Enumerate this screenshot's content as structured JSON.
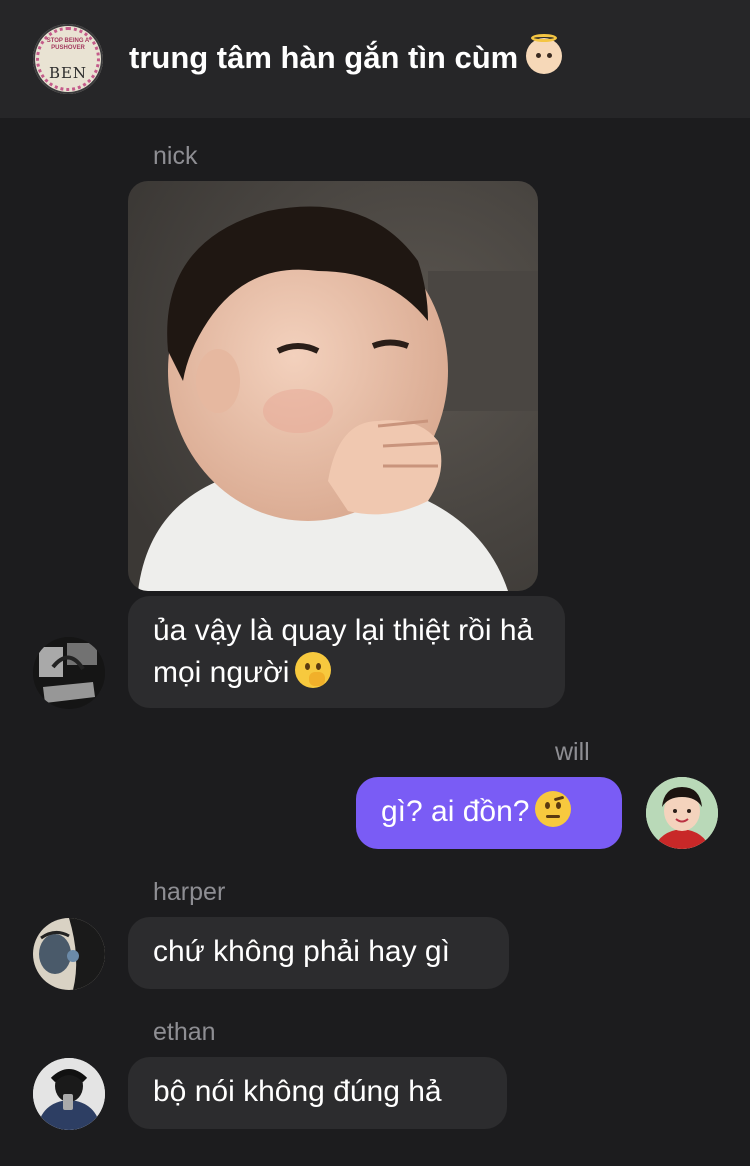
{
  "header": {
    "group_avatar_text": "BEN",
    "group_avatar_small_text": "STOP BEING A PUSHOVER",
    "title": "trung tâm hàn gắn tìn cùm",
    "title_emoji": "baby-angel-emoji"
  },
  "messages": [
    {
      "sender": "nick",
      "image": "photo-of-toddler-covering-mouth",
      "text": "ủa vậy là quay lại thiệt rồi hả mọi người",
      "emoji": "face-with-hand-over-mouth-emoji",
      "mine": false
    },
    {
      "sender": "will",
      "text": "gì? ai đồn?",
      "emoji": "face-with-raised-eyebrow-emoji",
      "mine": true
    },
    {
      "sender": "harper",
      "text": "chứ không phải hay gì",
      "mine": false
    },
    {
      "sender": "ethan",
      "text": "bộ nói không đúng hả",
      "mine": false
    }
  ],
  "colors": {
    "background": "#1c1c1e",
    "header": "#262628",
    "bubble_other": "#2c2c2e",
    "bubble_mine": "#7a5cf5",
    "sender_name": "#8e8e93"
  }
}
